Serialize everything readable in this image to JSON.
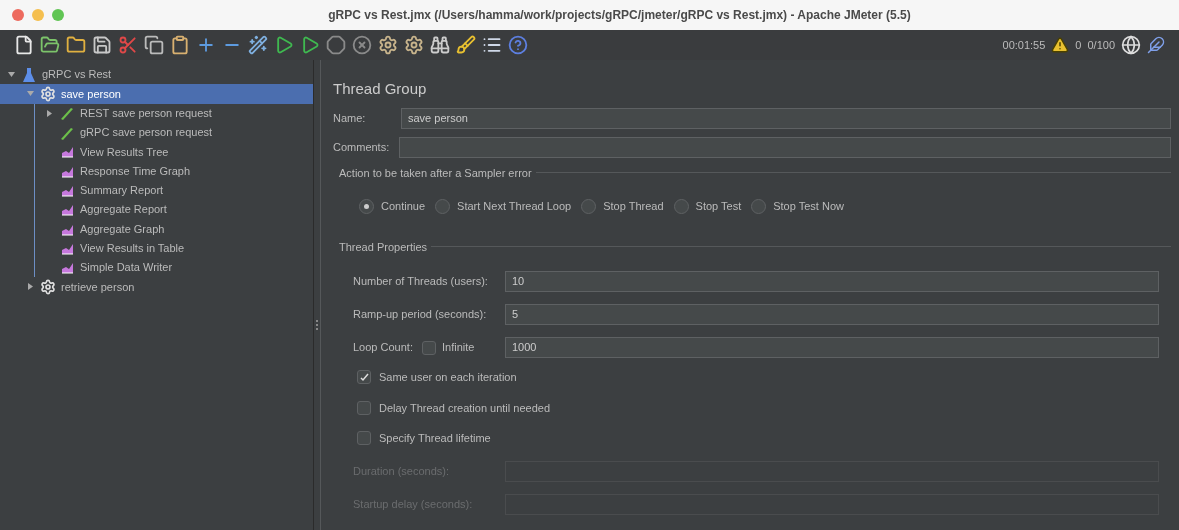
{
  "window": {
    "title": "gRPC vs Rest.jmx (/Users/hamma/work/projects/gRPC/jmeter/gRPC vs Rest.jmx) - Apache JMeter (5.5)"
  },
  "toolbar": {
    "elapsed": "00:01:55",
    "error_count": "0",
    "threads": "0/100"
  },
  "tree": [
    {
      "label": "gRPC vs Rest",
      "kind": "test-plan",
      "selected": false,
      "expanded": true,
      "children": [
        {
          "label": "save person",
          "kind": "thread-group",
          "selected": true,
          "expanded": true,
          "children": [
            {
              "label": "REST save person request",
              "kind": "sampler",
              "selected": false,
              "expanded": false
            },
            {
              "label": "gRPC save person request",
              "kind": "sampler",
              "selected": false
            },
            {
              "label": "View Results Tree",
              "kind": "listener",
              "selected": false
            },
            {
              "label": "Response Time Graph",
              "kind": "listener",
              "selected": false
            },
            {
              "label": "Summary Report",
              "kind": "listener",
              "selected": false
            },
            {
              "label": "Aggregate Report",
              "kind": "listener",
              "selected": false
            },
            {
              "label": "Aggregate Graph",
              "kind": "listener",
              "selected": false
            },
            {
              "label": "View Results in Table",
              "kind": "listener",
              "selected": false
            },
            {
              "label": "Simple Data Writer",
              "kind": "listener",
              "selected": false
            }
          ]
        },
        {
          "label": "retrieve person",
          "kind": "thread-group",
          "selected": false,
          "expanded": false
        }
      ]
    }
  ],
  "panel": {
    "title": "Thread Group",
    "name": {
      "label": "Name:",
      "value": "save person"
    },
    "comments": {
      "label": "Comments:"
    },
    "sampler_error": {
      "legend": "Action to be taken after a Sampler error",
      "options": [
        {
          "label": "Continue",
          "selected": true
        },
        {
          "label": "Start Next Thread Loop",
          "selected": false
        },
        {
          "label": "Stop Thread",
          "selected": false
        },
        {
          "label": "Stop Test",
          "selected": false
        },
        {
          "label": "Stop Test Now",
          "selected": false
        }
      ]
    },
    "thread_properties": {
      "legend": "Thread Properties",
      "threads": {
        "label": "Number of Threads (users):",
        "value": "10"
      },
      "ramp_up": {
        "label": "Ramp-up period (seconds):",
        "value": "5"
      },
      "loop_count": {
        "label": "Loop Count:",
        "infinite": {
          "label": "Infinite",
          "checked": false
        },
        "value": "1000"
      },
      "checkboxes": [
        {
          "label": "Same user on each iteration",
          "checked": true
        },
        {
          "label": "Delay Thread creation until needed",
          "checked": false
        },
        {
          "label": "Specify Thread lifetime",
          "checked": false
        }
      ],
      "duration": {
        "label": "Duration (seconds):",
        "disabled": true
      },
      "startup_delay": {
        "label": "Startup delay (seconds):",
        "disabled": true
      }
    }
  }
}
